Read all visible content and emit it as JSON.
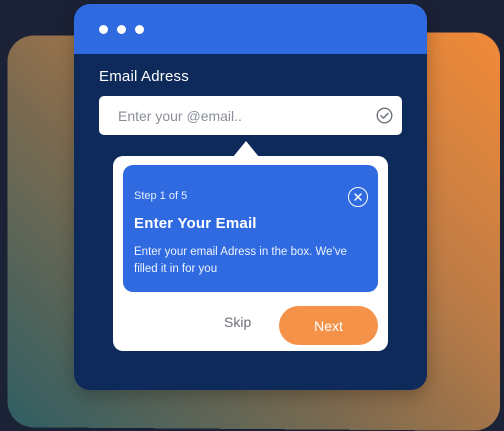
{
  "window": {
    "titlebar_dots": [
      "dot",
      "dot",
      "dot"
    ]
  },
  "form": {
    "email_label": "Email Adress",
    "email_placeholder": "Enter your @email..",
    "email_value": ""
  },
  "onboarding": {
    "step": "Step 1 of 5",
    "title": "Enter Your Email",
    "body": "Enter your email Adress in the box. We've filled it in for you",
    "skip_label": "Skip",
    "next_label": "Next"
  },
  "colors": {
    "titlebar": "#2f6ae0",
    "window": "#0e2a5a",
    "accent_orange": "#f5924a",
    "tip_card": "#2f6ae0"
  },
  "icons": {
    "input_status": "check-circle-icon",
    "close": "close-circle-icon"
  }
}
